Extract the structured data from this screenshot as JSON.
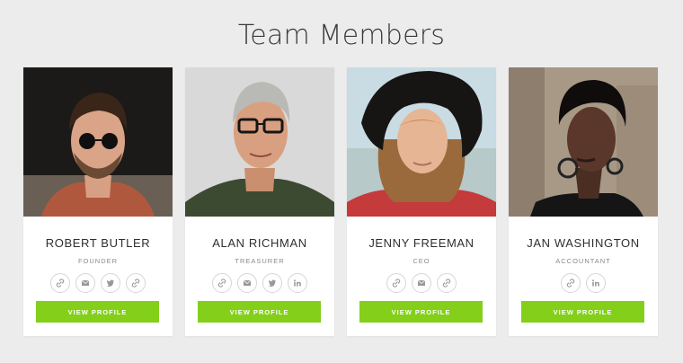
{
  "page_title": "Team Members",
  "accent_color": "#83cf1a",
  "members": [
    {
      "name": "ROBERT BUTLER",
      "role": "FOUNDER",
      "photo": "portrait-man-sunglasses",
      "socials": [
        "link-icon",
        "email-icon",
        "twitter-icon",
        "link-icon"
      ],
      "button_label": "VIEW PROFILE"
    },
    {
      "name": "ALAN RICHMAN",
      "role": "TREASURER",
      "photo": "portrait-man-glasses",
      "socials": [
        "link-icon",
        "email-icon",
        "twitter-icon",
        "linkedin-icon"
      ],
      "button_label": "VIEW PROFILE"
    },
    {
      "name": "JENNY FREEMAN",
      "role": "CEO",
      "photo": "portrait-woman-hat",
      "socials": [
        "link-icon",
        "email-icon",
        "link-icon"
      ],
      "button_label": "VIEW PROFILE"
    },
    {
      "name": "JAN WASHINGTON",
      "role": "ACCOUNTANT",
      "photo": "portrait-woman-earrings",
      "socials": [
        "link-icon",
        "linkedin-icon"
      ],
      "button_label": "VIEW PROFILE"
    }
  ]
}
